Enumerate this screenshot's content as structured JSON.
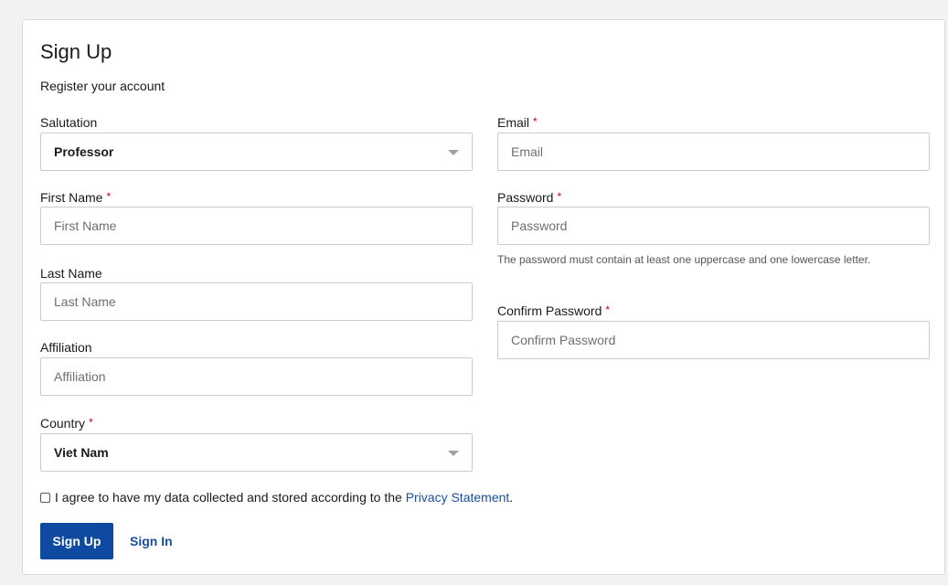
{
  "form": {
    "title": "Sign Up",
    "subtitle": "Register your account",
    "required_mark": "*"
  },
  "fields": {
    "salutation": {
      "label": "Salutation",
      "value": "Professor"
    },
    "first_name": {
      "label": "First Name",
      "placeholder": "First Name",
      "value": ""
    },
    "last_name": {
      "label": "Last Name",
      "placeholder": "Last Name",
      "value": ""
    },
    "affiliation": {
      "label": "Affiliation",
      "placeholder": "Affiliation",
      "value": ""
    },
    "country": {
      "label": "Country",
      "value": "Viet Nam"
    },
    "email": {
      "label": "Email",
      "placeholder": "Email",
      "value": ""
    },
    "password": {
      "label": "Password",
      "placeholder": "Password",
      "value": "",
      "hint": "The password must contain at least one uppercase and one lowercase letter."
    },
    "confirm_password": {
      "label": "Confirm Password",
      "placeholder": "Confirm Password",
      "value": ""
    }
  },
  "consent": {
    "checked": false,
    "text": "I agree to have my data collected and stored according to the ",
    "link_label": "Privacy Statement",
    "suffix": "."
  },
  "actions": {
    "sign_up_label": "Sign Up",
    "sign_in_label": "Sign In"
  },
  "colors": {
    "primary": "#0d4aa0",
    "link": "#1a4fa0",
    "required": "#d0021b"
  },
  "icons": {
    "select_caret": "chevron-down-icon"
  }
}
